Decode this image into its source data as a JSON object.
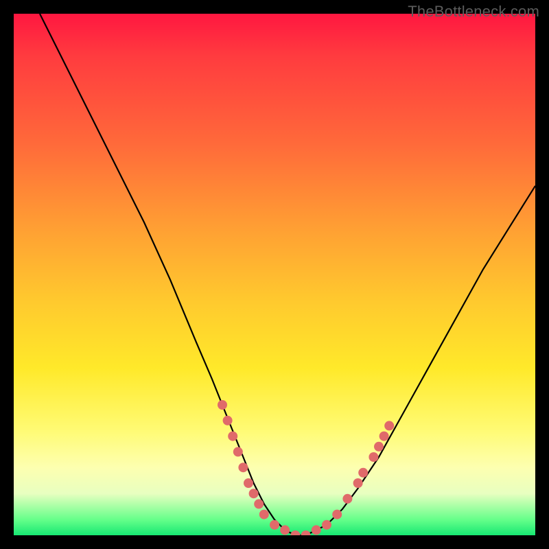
{
  "watermark": "TheBottleneck.com",
  "chart_data": {
    "type": "line",
    "title": "",
    "xlabel": "",
    "ylabel": "",
    "xlim": [
      0,
      100
    ],
    "ylim": [
      0,
      100
    ],
    "grid": false,
    "legend": false,
    "series": [
      {
        "name": "bottleneck-curve",
        "x": [
          5,
          10,
          15,
          20,
          25,
          30,
          35,
          38,
          40,
          42,
          44,
          46,
          48,
          50,
          52,
          54,
          56,
          58,
          60,
          63,
          66,
          70,
          75,
          80,
          85,
          90,
          95,
          100
        ],
        "values": [
          100,
          90,
          80,
          70,
          60,
          49,
          37,
          30,
          25,
          20,
          15,
          10,
          6,
          3,
          1,
          0,
          0,
          1,
          2,
          5,
          9,
          15,
          24,
          33,
          42,
          51,
          59,
          67
        ]
      }
    ],
    "markers": [
      {
        "x": 40,
        "y": 25
      },
      {
        "x": 41,
        "y": 22
      },
      {
        "x": 42,
        "y": 19
      },
      {
        "x": 43,
        "y": 16
      },
      {
        "x": 44,
        "y": 13
      },
      {
        "x": 45,
        "y": 10
      },
      {
        "x": 46,
        "y": 8
      },
      {
        "x": 47,
        "y": 6
      },
      {
        "x": 48,
        "y": 4
      },
      {
        "x": 50,
        "y": 2
      },
      {
        "x": 52,
        "y": 1
      },
      {
        "x": 54,
        "y": 0
      },
      {
        "x": 56,
        "y": 0
      },
      {
        "x": 58,
        "y": 1
      },
      {
        "x": 60,
        "y": 2
      },
      {
        "x": 62,
        "y": 4
      },
      {
        "x": 64,
        "y": 7
      },
      {
        "x": 66,
        "y": 10
      },
      {
        "x": 67,
        "y": 12
      },
      {
        "x": 69,
        "y": 15
      },
      {
        "x": 70,
        "y": 17
      },
      {
        "x": 71,
        "y": 19
      },
      {
        "x": 72,
        "y": 21
      }
    ],
    "colors": {
      "gradient_top": "#ff1740",
      "gradient_mid": "#ffe92a",
      "gradient_bottom": "#17e873",
      "curve": "#000000",
      "markers": "#e06a6a"
    }
  }
}
